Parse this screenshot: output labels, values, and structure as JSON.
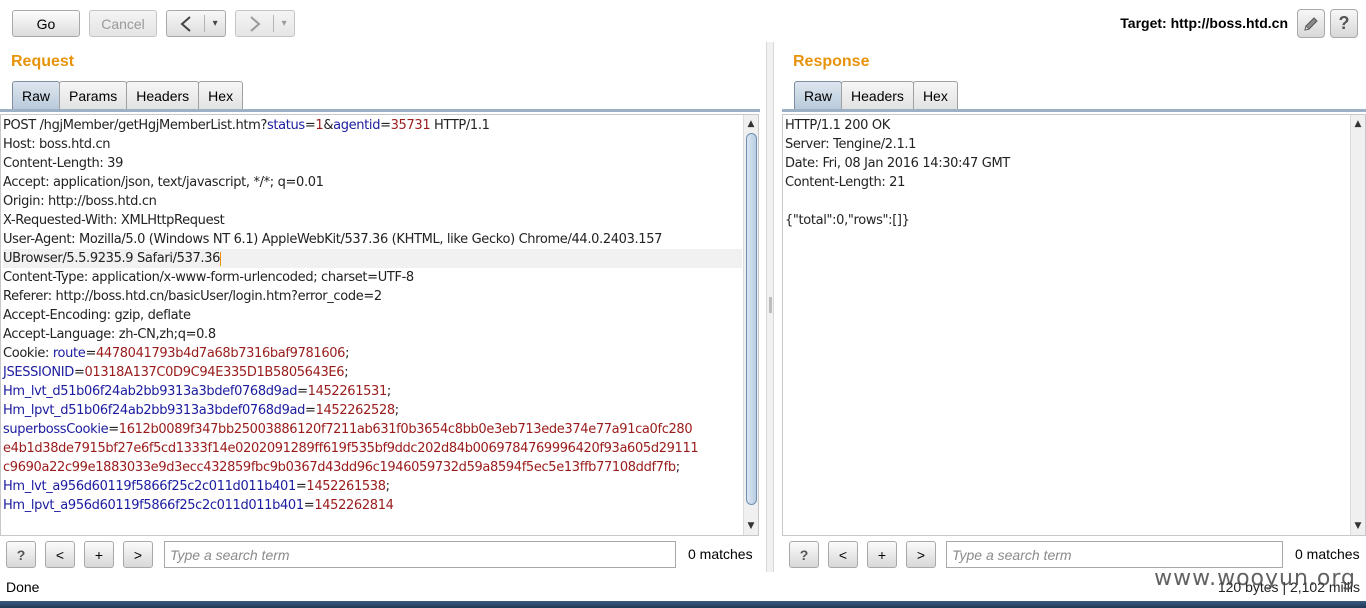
{
  "toolbar": {
    "go_label": "Go",
    "cancel_label": "Cancel",
    "back_label": "<",
    "forward_label": ">",
    "dropdown_glyph": "▾",
    "target_label": "Target: http://boss.htd.cn",
    "edit_icon": "pencil-icon",
    "help_label": "?"
  },
  "request": {
    "title": "Request",
    "tabs": [
      "Raw",
      "Params",
      "Headers",
      "Hex"
    ],
    "active_tab": "Raw",
    "lines": [
      {
        "segments": [
          [
            "t",
            "POST /hgjMember/getHgjMemberList.htm?"
          ],
          [
            "k",
            "status"
          ],
          [
            "t",
            "="
          ],
          [
            "v",
            "1"
          ],
          [
            "t",
            "&"
          ],
          [
            "k",
            "agentid"
          ],
          [
            "t",
            "="
          ],
          [
            "v",
            "35731"
          ],
          [
            "t",
            " HTTP/1.1"
          ]
        ]
      },
      {
        "segments": [
          [
            "t",
            "Host: boss.htd.cn"
          ]
        ]
      },
      {
        "segments": [
          [
            "t",
            "Content-Length: 39"
          ]
        ]
      },
      {
        "segments": [
          [
            "t",
            "Accept: application/json, text/javascript, */*; q=0.01"
          ]
        ]
      },
      {
        "segments": [
          [
            "t",
            "Origin: http://boss.htd.cn"
          ]
        ]
      },
      {
        "segments": [
          [
            "t",
            "X-Requested-With: XMLHttpRequest"
          ]
        ]
      },
      {
        "segments": [
          [
            "t",
            "User-Agent: Mozilla/5.0 (Windows NT 6.1) AppleWebKit/537.36 (KHTML, like Gecko) Chrome/44.0.2403.157"
          ]
        ]
      },
      {
        "segments": [
          [
            "t",
            "UBrowser/5.5.9235.9 Safari/537.36"
          ]
        ],
        "cursor": true
      },
      {
        "segments": [
          [
            "t",
            "Content-Type: application/x-www-form-urlencoded; charset=UTF-8"
          ]
        ]
      },
      {
        "segments": [
          [
            "t",
            "Referer: http://boss.htd.cn/basicUser/login.htm?error_code=2"
          ]
        ]
      },
      {
        "segments": [
          [
            "t",
            "Accept-Encoding: gzip, deflate"
          ]
        ]
      },
      {
        "segments": [
          [
            "t",
            "Accept-Language: zh-CN,zh;q=0.8"
          ]
        ]
      },
      {
        "segments": [
          [
            "t",
            "Cookie: "
          ],
          [
            "k",
            "route"
          ],
          [
            "t",
            "="
          ],
          [
            "v",
            "4478041793b4d7a68b7316baf9781606"
          ],
          [
            "t",
            ";"
          ]
        ]
      },
      {
        "segments": [
          [
            "k",
            "JSESSIONID"
          ],
          [
            "t",
            "="
          ],
          [
            "v",
            "01318A137C0D9C94E335D1B5805643E6"
          ],
          [
            "t",
            ";"
          ]
        ]
      },
      {
        "segments": [
          [
            "k",
            "Hm_lvt_d51b06f24ab2bb9313a3bdef0768d9ad"
          ],
          [
            "t",
            "="
          ],
          [
            "v",
            "1452261531"
          ],
          [
            "t",
            ";"
          ]
        ]
      },
      {
        "segments": [
          [
            "k",
            "Hm_lpvt_d51b06f24ab2bb9313a3bdef0768d9ad"
          ],
          [
            "t",
            "="
          ],
          [
            "v",
            "1452262528"
          ],
          [
            "t",
            ";"
          ]
        ]
      },
      {
        "segments": [
          [
            "k",
            "superbossCookie"
          ],
          [
            "t",
            "="
          ],
          [
            "v",
            "1612b0089f347bb25003886120f7211ab631f0b3654c8bb0e3eb713ede374e77a91ca0fc280"
          ]
        ]
      },
      {
        "segments": [
          [
            "v",
            "e4b1d38de7915bf27e6f5cd1333f14e0202091289ff619f535bf9ddc202d84b0069784769996420f93a605d29111"
          ]
        ]
      },
      {
        "segments": [
          [
            "v",
            "c9690a22c99e1883033e9d3ecc432859fbc9b0367d43dd96c1946059732d59a8594f5ec5e13ffb77108ddf7fb"
          ],
          [
            "t",
            ";"
          ]
        ]
      },
      {
        "segments": [
          [
            "k",
            "Hm_lvt_a956d60119f5866f25c2c011d011b401"
          ],
          [
            "t",
            "="
          ],
          [
            "v",
            "1452261538"
          ],
          [
            "t",
            ";"
          ]
        ]
      },
      {
        "segments": [
          [
            "k",
            "Hm_lpvt_a956d60119f5866f25c2c011d011b401"
          ],
          [
            "t",
            "="
          ],
          [
            "v",
            "1452262814"
          ]
        ]
      }
    ],
    "search_placeholder": "Type a search term",
    "matches_label": "0 matches"
  },
  "response": {
    "title": "Response",
    "tabs": [
      "Raw",
      "Headers",
      "Hex"
    ],
    "active_tab": "Raw",
    "lines": [
      {
        "segments": [
          [
            "t",
            "HTTP/1.1 200 OK"
          ]
        ]
      },
      {
        "segments": [
          [
            "t",
            "Server: Tengine/2.1.1"
          ]
        ]
      },
      {
        "segments": [
          [
            "t",
            "Date: Fri, 08 Jan 2016 14:30:47 GMT"
          ]
        ]
      },
      {
        "segments": [
          [
            "t",
            "Content-Length: 21"
          ]
        ]
      },
      {
        "segments": [
          [
            "t",
            ""
          ]
        ]
      },
      {
        "segments": [
          [
            "t",
            "{\"total\":0,\"rows\":[]}"
          ]
        ]
      }
    ],
    "search_placeholder": "Type a search term",
    "matches_label": "0 matches"
  },
  "search_controls": {
    "help_label": "?",
    "prev_label": "<",
    "add_label": "+",
    "next_label": ">"
  },
  "status": {
    "left": "Done",
    "right": "120 bytes | 2,102 millis"
  },
  "watermark": "www.wooyun.org"
}
